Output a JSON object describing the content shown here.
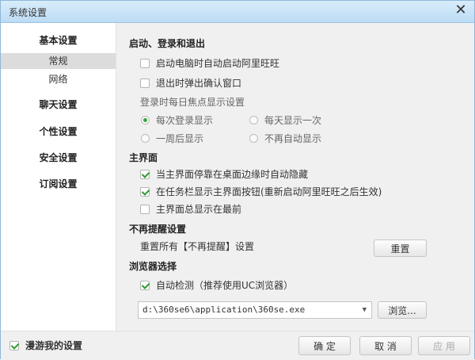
{
  "window": {
    "title": "系统设置",
    "close_glyph": "✕"
  },
  "sidebar": {
    "items": [
      {
        "label": "基本设置"
      },
      {
        "label": "常规"
      },
      {
        "label": "网络"
      },
      {
        "label": "聊天设置"
      },
      {
        "label": "个性设置"
      },
      {
        "label": "安全设置"
      },
      {
        "label": "订阅设置"
      }
    ]
  },
  "startup": {
    "title": "启动、登录和退出",
    "autostart_label": "启动电脑时自动启动阿里旺旺",
    "autostart_checked": false,
    "confirm_exit_label": "退出时弹出确认窗口",
    "confirm_exit_checked": false,
    "focus_label": "登录时每日焦点显示设置",
    "focus_options": [
      {
        "label": "每次登录显示",
        "checked": true
      },
      {
        "label": "每天显示一次",
        "checked": false
      },
      {
        "label": "一周后显示",
        "checked": false
      },
      {
        "label": "不再自动显示",
        "checked": false
      }
    ]
  },
  "main_panel": {
    "title": "主界面",
    "autohide_label": "当主界面停靠在桌面边缘时自动隐藏",
    "autohide_checked": true,
    "taskbar_label": "在任务栏显示主界面按钮(重新启动阿里旺旺之后生效)",
    "taskbar_checked": true,
    "topmost_label": "主界面总显示在最前",
    "topmost_checked": false
  },
  "reminders": {
    "title": "不再提醒设置",
    "reset_text": "重置所有【不再提醒】设置",
    "reset_button": "重置"
  },
  "browser": {
    "title": "浏览器选择",
    "autodetect_label": "自动检测（推荐使用UC浏览器）",
    "autodetect_checked": true,
    "path_value": "d:\\360se6\\application\\360se.exe",
    "dropdown_glyph": "▼",
    "browse_button": "浏览..."
  },
  "footer": {
    "roam_label": "漫游我的设置",
    "roam_checked": true,
    "ok_button": "确 定",
    "cancel_button": "取 消",
    "apply_button": "应 用"
  }
}
